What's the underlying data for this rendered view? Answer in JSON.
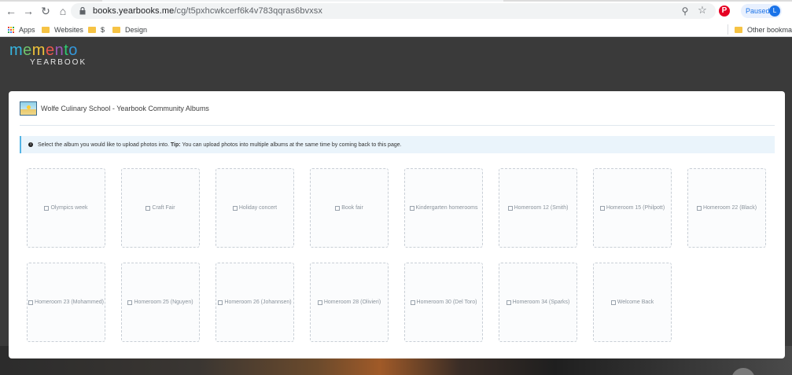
{
  "browser": {
    "url_host": "books.yearbooks.me",
    "url_path": "/cg/t5pxhcwkcerf6k4v783qq",
    "url_rest": "ras6bvxsx",
    "profile_label": "Paused",
    "profile_initial": "L",
    "pinterest_letter": "P"
  },
  "bookmarks": {
    "apps": "Apps",
    "websites": "Websites",
    "dollar": "$",
    "design": "Design",
    "other": "Other bookmarks"
  },
  "logo": {
    "letters": [
      "m",
      "e",
      "m",
      "e",
      "n",
      "t",
      "o"
    ],
    "subtitle": "YEARBOOK"
  },
  "card": {
    "title": "Wolfe Culinary School - Yearbook Community Albums",
    "tip_prefix": "Select the album you would like to upload photos into.",
    "tip_label": "Tip:",
    "tip_text": "You can upload photos into multiple albums at the same time by coming back to this page."
  },
  "albums": [
    "Olympics week",
    "Craft Fair",
    "Holiday concert",
    "Book fair",
    "Kindergarten homerooms",
    "Homeroom 12 (Smith)",
    "Homeroom 15 (Philpott)",
    "Homeroom 22 (Black)",
    "Homeroom 23 (Mohammed)",
    "Homeroom 25 (Nguyen)",
    "Homeroom 26 (Johannsen)",
    "Homeroom 28 (Olivieri)",
    "Homeroom 30 (Del Toro)",
    "Homeroom 34 (Sparks)",
    "Welcome Back"
  ],
  "colors": {
    "logo": [
      "#36b5e0",
      "#6fc36b",
      "#f0c23a",
      "#e8554e",
      "#9b59b6",
      "#2ecc71",
      "#3498db"
    ],
    "tip_accent": "#53b4e5"
  }
}
